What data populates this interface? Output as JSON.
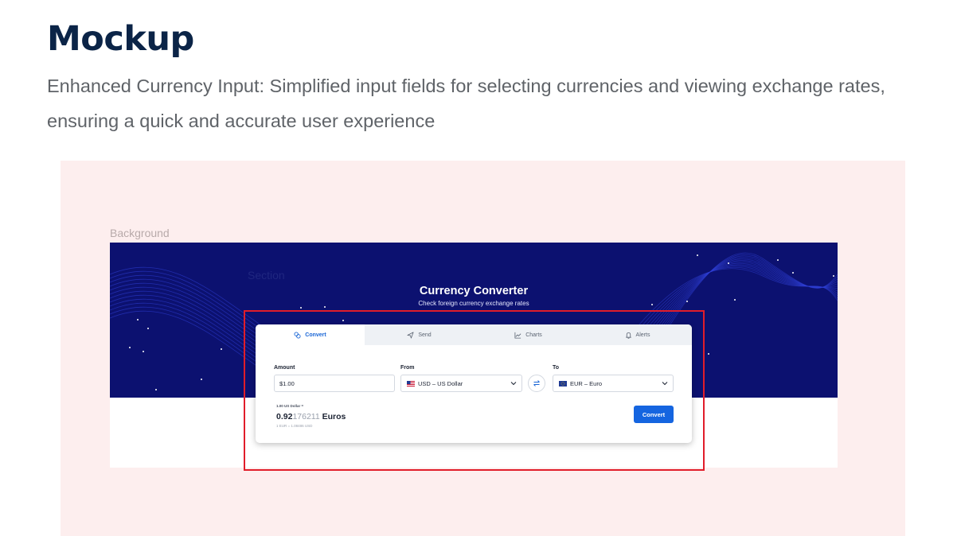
{
  "heading": "Mockup",
  "subtitle": "Enhanced Currency Input: Simplified input fields for selecting currencies and viewing exchange rates, ensuring a quick and accurate user experience",
  "frame": {
    "label": "Background",
    "section_label": "Section"
  },
  "converter": {
    "title": "Currency Converter",
    "subtitle": "Check foreign currency exchange rates",
    "tabs": [
      {
        "label": "Convert",
        "icon": "convert-icon",
        "active": true
      },
      {
        "label": "Send",
        "icon": "send-icon",
        "active": false
      },
      {
        "label": "Charts",
        "icon": "chart-icon",
        "active": false
      },
      {
        "label": "Alerts",
        "icon": "bell-icon",
        "active": false
      }
    ],
    "amount": {
      "label": "Amount",
      "value": "$1.00"
    },
    "from": {
      "label": "From",
      "value": "USD – US Dollar",
      "flag": "us-flag-icon"
    },
    "to": {
      "label": "To",
      "value": "EUR – Euro",
      "flag": "eu-flag-icon"
    },
    "swap_icon": "swap-arrows-icon",
    "result": {
      "small": "1.00 US Dollar =",
      "main_bold": "0.92",
      "main_faded": "176211",
      "unit": " Euros",
      "footnote": "1 EUR = 1.08486 USD"
    },
    "convert_button": "Convert"
  },
  "colors": {
    "hero_bg": "#0c1170",
    "accent": "#1565e0",
    "canvas_bg": "#fdeeee",
    "highlight": "#e11d2a",
    "heading": "#0b2447"
  }
}
